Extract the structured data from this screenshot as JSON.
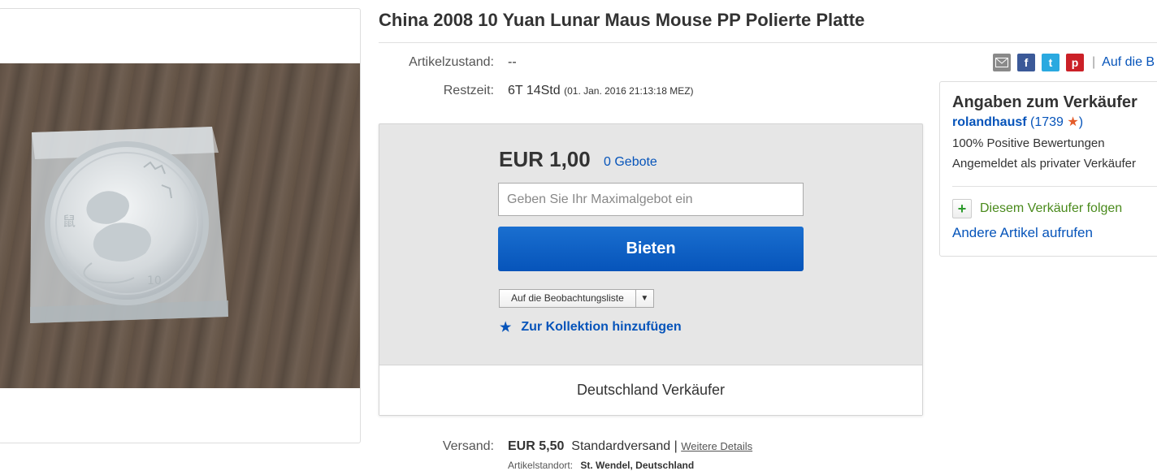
{
  "listing": {
    "title": "China 2008 10 Yuan Lunar Maus Mouse PP Polierte Platte",
    "condition_label": "Artikelzustand:",
    "condition_value": "--",
    "time_label": "Restzeit:",
    "time_value": "6T 14Std",
    "end_date": "(01. Jan. 2016   21:13:18 MEZ)"
  },
  "share": {
    "icons": [
      "email-icon",
      "facebook-icon",
      "twitter-icon",
      "pinterest-icon"
    ],
    "separator": "|",
    "link": "Auf die B"
  },
  "bid": {
    "price": "EUR 1,00",
    "bids": "0 Gebote",
    "input_placeholder": "Geben Sie Ihr Maximalgebot ein",
    "button": "Bieten",
    "watch_label": "Auf die Beobachtungsliste",
    "collection": "Zur Kollektion hinzufügen",
    "footer": "Deutschland Verkäufer",
    "accent": "#0654ba"
  },
  "seller": {
    "heading": "Angaben zum Verkäufer",
    "username": "rolandhausf",
    "score_open": "(",
    "score": "1739",
    "score_close": ")",
    "feedback": "100% Positive Bewertungen",
    "registered": "Angemeldet als privater Verkäufer",
    "follow": "Diesem Verkäufer folgen",
    "other_items": "Andere Artikel aufrufen"
  },
  "shipping": {
    "label": "Versand:",
    "price": "EUR 5,50",
    "method": "Standardversand",
    "separator": "|",
    "details_link": "Weitere Details",
    "location_label": "Artikelstandort:",
    "location": "St. Wendel, Deutschland"
  }
}
